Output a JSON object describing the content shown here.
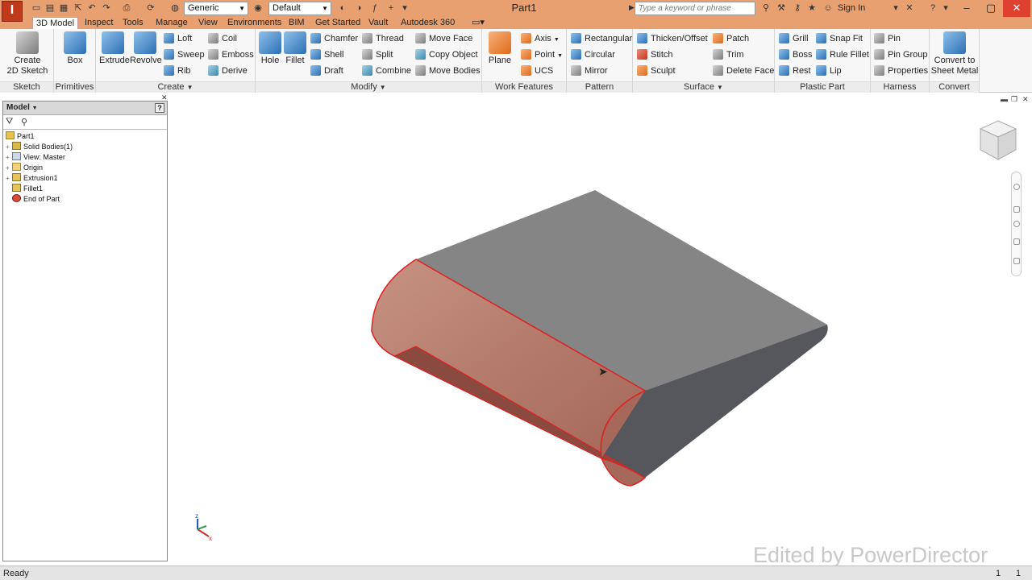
{
  "titlebar": {
    "logo_letter": "I",
    "material_combo": "Generic",
    "appearance_combo": "Default",
    "doc_title": "Part1",
    "search_placeholder": "Type a keyword or phrase",
    "sign_in": "Sign In"
  },
  "tabs": [
    "3D Model",
    "Inspect",
    "Tools",
    "Manage",
    "View",
    "Environments",
    "BIM",
    "Get Started",
    "Vault",
    "Autodesk 360"
  ],
  "ribbon": {
    "sketch": {
      "label": "Sketch",
      "create_2d_sketch": "Create\n2D Sketch"
    },
    "primitives": {
      "label": "Primitives",
      "box": "Box"
    },
    "create": {
      "label": "Create",
      "extrude": "Extrude",
      "revolve": "Revolve",
      "loft": "Loft",
      "sweep": "Sweep",
      "rib": "Rib",
      "coil": "Coil",
      "emboss": "Emboss",
      "derive": "Derive"
    },
    "modify": {
      "label": "Modify",
      "hole": "Hole",
      "fillet": "Fillet",
      "chamfer": "Chamfer",
      "shell": "Shell",
      "draft": "Draft",
      "thread": "Thread",
      "split": "Split",
      "combine": "Combine",
      "move_face": "Move Face",
      "copy_object": "Copy Object",
      "move_bodies": "Move Bodies"
    },
    "work_features": {
      "label": "Work Features",
      "plane": "Plane",
      "axis": "Axis",
      "point": "Point",
      "ucs": "UCS"
    },
    "pattern": {
      "label": "Pattern",
      "rectangular": "Rectangular",
      "circular": "Circular",
      "mirror": "Mirror"
    },
    "surface": {
      "label": "Surface",
      "thicken_offset": "Thicken/Offset",
      "stitch": "Stitch",
      "sculpt": "Sculpt",
      "patch": "Patch",
      "trim": "Trim",
      "delete_face": "Delete Face"
    },
    "plastic_part": {
      "label": "Plastic Part",
      "grill": "Grill",
      "boss": "Boss",
      "rest": "Rest",
      "snap_fit": "Snap Fit",
      "rule_fillet": "Rule Fillet",
      "lip": "Lip"
    },
    "harness": {
      "label": "Harness",
      "pin": "Pin",
      "pin_group": "Pin Group",
      "properties": "Properties"
    },
    "convert": {
      "label": "Convert",
      "convert_sheet_metal": "Convert to\nSheet Metal"
    }
  },
  "browser": {
    "title": "Model",
    "tree": [
      {
        "label": "Part1",
        "icon": "part-icon"
      },
      {
        "label": "Solid Bodies(1)",
        "icon": "solid-bodies-icon"
      },
      {
        "label": "View: Master",
        "icon": "view-icon"
      },
      {
        "label": "Origin",
        "icon": "folder-icon"
      },
      {
        "label": "Extrusion1",
        "icon": "extrusion-icon"
      },
      {
        "label": "Fillet1",
        "icon": "fillet-icon"
      },
      {
        "label": "End of Part",
        "icon": "end-of-part-icon"
      }
    ]
  },
  "viewport": {
    "triad_z_label": "z",
    "triad_x_label": "x",
    "watermark": "Edited by PowerDirector"
  },
  "statusbar": {
    "status": "Ready",
    "count_a": "1",
    "count_b": "1"
  },
  "colors": {
    "title_bar": "#e8a070",
    "selection": "#e02020",
    "body": "#8c8c8c"
  }
}
